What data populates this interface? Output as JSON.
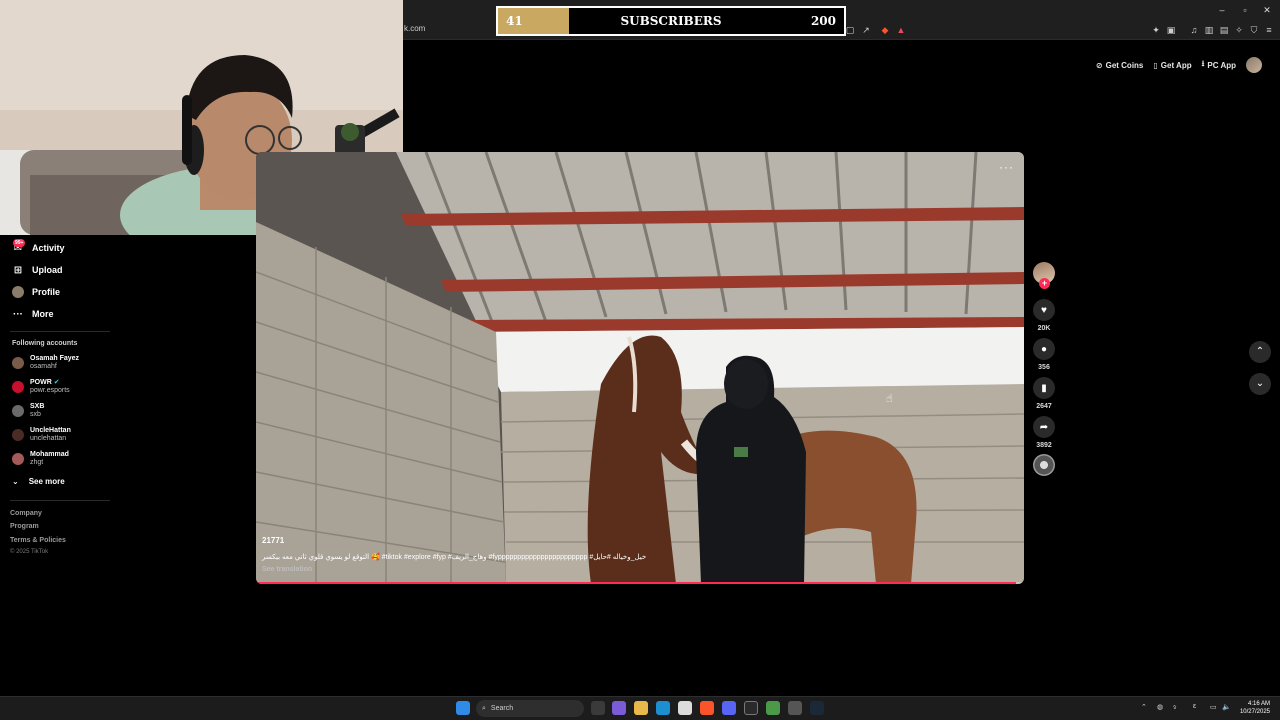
{
  "browser": {
    "url_fragment": "k.com",
    "window_controls": [
      "–",
      "▫",
      "✕"
    ]
  },
  "subscriber_goal": {
    "current": "41",
    "label": "SUBSCRIBERS",
    "target": "200",
    "progress_fraction": 0.205,
    "fill_color": "#c9a862"
  },
  "top_actions": {
    "get_coins": "Get Coins",
    "get_app": "Get App",
    "pc_app": "PC App"
  },
  "sidebar": {
    "badge": "99+",
    "items": [
      {
        "label": "Activity",
        "icon": "activity-icon"
      },
      {
        "label": "Upload",
        "icon": "upload-icon"
      },
      {
        "label": "Profile",
        "icon": "profile-icon"
      },
      {
        "label": "More",
        "icon": "more-icon"
      }
    ],
    "following_title": "Following accounts",
    "accounts": [
      {
        "name": "Osamah Fayez",
        "handle": "osamahf",
        "color": "#7a5b4a"
      },
      {
        "name": "POWR",
        "handle": "powr.esports",
        "color": "#c8102e"
      },
      {
        "name": "SXB",
        "handle": "sxb",
        "color": "#6a6a6a"
      },
      {
        "name": "UncleHattan",
        "handle": "unclehattan",
        "color": "#4b2c24"
      },
      {
        "name": "Mohammad",
        "handle": "zhgt",
        "color": "#a55a5a"
      }
    ],
    "see_more": "See more",
    "footer": [
      "Company",
      "Program",
      "Terms & Policies"
    ],
    "copyright": "© 2025 TikTok"
  },
  "video": {
    "username": "21771",
    "caption": "التوقع لو يسوي قلوي ثاني معه بيكسر 🥰 #tiktok #explore #fyp #وهاج_الريف #fyppppppppppppppppppppppp #خيل_وخياله #حايل",
    "see_translation": "See translation",
    "progress_fraction": 0.99
  },
  "rail": {
    "likes": "20K",
    "comments": "356",
    "saves": "2647",
    "shares": "3892"
  },
  "taskbar": {
    "search_label": "Search",
    "time": "4:16 AM",
    "date": "10/27/2025"
  }
}
